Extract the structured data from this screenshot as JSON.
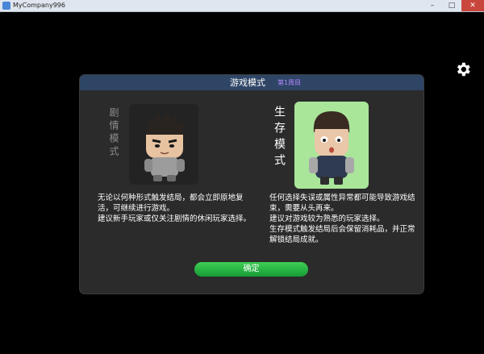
{
  "window": {
    "title": "MyCompany996",
    "minimize_glyph": "–",
    "maximize_glyph": "□",
    "close_glyph": "✕"
  },
  "settings": {
    "icon": "gear-icon"
  },
  "dialog": {
    "title": "游戏模式",
    "subtitle": "第1周目",
    "modes": {
      "story": {
        "label": "剧情模式",
        "description": "无论以何种形式触发结局，都会立即原地复活，可继续进行游戏。\n建议新手玩家或仅关注剧情的休闲玩家选择。"
      },
      "survival": {
        "label": "生存模式",
        "description": "任何选择失误或属性异常都可能导致游戏结束，需要从头再来。\n建议对游戏较为熟悉的玩家选择。\n生存模式触发结局后会保留消耗品，并正常解锁结局成就。"
      }
    },
    "confirm_label": "确定"
  },
  "colors": {
    "header": "#2e4566",
    "subtitle": "#b487ff",
    "confirm": "#22b13f",
    "survival_bg": "#a9e69a"
  }
}
